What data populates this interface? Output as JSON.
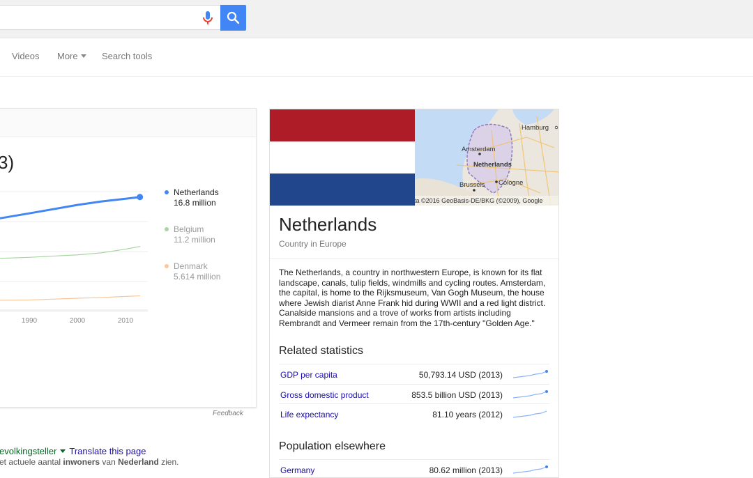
{
  "tabs": [
    {
      "label": "Videos"
    },
    {
      "label": "More"
    },
    {
      "label": "Search tools"
    }
  ],
  "chart_card": {
    "title": "3)",
    "feedback": "Feedback"
  },
  "chart_data": {
    "type": "line",
    "x_ticks": [
      "1990",
      "2000",
      "2010"
    ],
    "series": [
      {
        "name": "Netherlands",
        "value_label": "16.8 million",
        "color": "#4285f4",
        "points": [
          [
            1984,
            14.4
          ],
          [
            1990,
            14.95
          ],
          [
            2000,
            15.9
          ],
          [
            2005,
            16.3
          ],
          [
            2010,
            16.6
          ],
          [
            2013,
            16.8
          ]
        ]
      },
      {
        "name": "Belgium",
        "value_label": "11.2 million",
        "color": "#a8d5a2",
        "points": [
          [
            1984,
            9.86
          ],
          [
            1990,
            9.97
          ],
          [
            2000,
            10.25
          ],
          [
            2005,
            10.48
          ],
          [
            2010,
            10.9
          ],
          [
            2013,
            11.2
          ]
        ]
      },
      {
        "name": "Denmark",
        "value_label": "5.614 million",
        "color": "#f9c79a",
        "points": [
          [
            1984,
            5.11
          ],
          [
            1990,
            5.14
          ],
          [
            2000,
            5.34
          ],
          [
            2005,
            5.42
          ],
          [
            2010,
            5.55
          ],
          [
            2013,
            5.614
          ]
        ]
      }
    ]
  },
  "result": {
    "source_fragment": "evolkingsteller",
    "translate": "Translate this page",
    "snippet_pre": "et actuele aantal ",
    "snippet_b1": "inwoners",
    "snippet_mid": " van ",
    "snippet_b2": "Nederland",
    "snippet_post": " zien."
  },
  "knowledge_panel": {
    "flag_colors": [
      "#ae1c28",
      "#ffffff",
      "#21468b"
    ],
    "map": {
      "cities": [
        "Hamburg",
        "Amsterdam",
        "Netherlands",
        "Brussels",
        "Cologne"
      ],
      "attribution": "ta ©2016 GeoBasis-DE/BKG (©2009), Google"
    },
    "title": "Netherlands",
    "subtitle": "Country in Europe",
    "description": "The Netherlands, a country in northwestern Europe, is known for its flat landscape, canals, tulip fields, windmills and cycling routes. Amsterdam, the capital, is home to the Rijksmuseum, Van Gogh Museum, the house where Jewish diarist Anne Frank hid during WWII and a red light district. Canalside mansions and a trove of works from artists including Rembrandt and Vermeer remain from the 17th-century \"Golden Age.\"",
    "related_title": "Related statistics",
    "related": [
      {
        "label": "GDP per capita",
        "value": "50,793.14 USD (2013)"
      },
      {
        "label": "Gross domestic product",
        "value": "853.5 billion USD (2013)"
      },
      {
        "label": "Life expectancy",
        "value": "81.10 years (2012)"
      }
    ],
    "population_title": "Population elsewhere",
    "population": [
      {
        "label": "Germany",
        "value": "80.62 million (2013)"
      }
    ]
  }
}
